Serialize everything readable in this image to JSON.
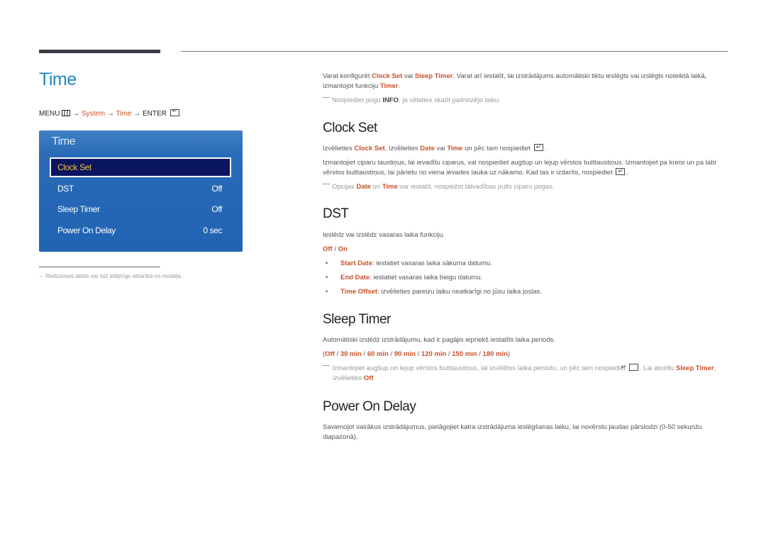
{
  "page": {
    "title": "Time",
    "menu_path": {
      "menu": "MENU",
      "arrow": "→",
      "system": "System",
      "time": "Time",
      "enter": "ENTER"
    }
  },
  "osd": {
    "title": "Time",
    "items": [
      {
        "label": "Clock Set",
        "value": ""
      },
      {
        "label": "DST",
        "value": "Off"
      },
      {
        "label": "Sleep Timer",
        "value": "Off"
      },
      {
        "label": "Power On Delay",
        "value": "0 sec"
      }
    ],
    "footnote": "Redzamais attēls var būt atšķirīgs atkarībā no modeļa."
  },
  "intro": {
    "t1": "Varat konfigurēt ",
    "clock_set": "Clock Set",
    "t2": " vai ",
    "sleep_timer": "Sleep Timer",
    "t3": ". Varat arī iestatīt, lai izstrādājums automātiski tiktu ieslēgts vai izslēgts noteiktā laikā, izmantojot funkciju ",
    "timer": "Timer",
    "t4": ".",
    "note_t1": "Nospiediet pogu ",
    "note_info": "INFO",
    "note_t2": ", ja vēlaties skatīt pašreizējo laiku."
  },
  "clock_set": {
    "heading": "Clock Set",
    "p1_t1": "Izvēlieties ",
    "p1_clock": "Clock Set",
    "p1_t2": ". Izvēlieties ",
    "p1_date": "Date",
    "p1_t3": " vai ",
    "p1_time": "Time",
    "p1_t4": " un pēc tam nospiediet",
    "p1_t5": ".",
    "p2_t1": "Izmantojiet ciparu taustiņus, lai ievadītu ciparus, vai nospiediet augšup un lejup vērstos bulttaustiņus. Izmantojiet pa kreisi un pa labi vērstos bulttaustiņus, lai pārietu no viena ievades lauka uz nākamo. Kad tas ir izdarīts, nospiediet",
    "p2_t2": ".",
    "note_t1": "Opcijas ",
    "note_date": "Date",
    "note_t2": " un ",
    "note_time": "Time",
    "note_t3": " var iestatīt, nospiežot tālvadības pults ciparu pogas."
  },
  "dst": {
    "heading": "DST",
    "desc": "Ieslēdz vai izslēdz vasaras laika funkciju.",
    "opt_off": "Off",
    "opt_sep": " / ",
    "opt_on": "On",
    "bullets": [
      {
        "term": "Start Date",
        "text": ": iestatiet vasaras laika sākuma datumu."
      },
      {
        "term": "End Date",
        "text": ": iestatiet vasaras laika beigu datumu."
      },
      {
        "term": "Time Offset",
        "text": ": izvēlieties pareizu laiku neatkarīgi no jūsu laika joslas."
      }
    ]
  },
  "sleep_timer": {
    "heading": "Sleep Timer",
    "desc": "Automātiski izslēdz izstrādājumu, kad ir pagājis iepriekš iestatīts laika periods.",
    "options": [
      "Off",
      "30 min",
      "60 min",
      "90 min",
      "120 min",
      "150 min",
      "180 min"
    ],
    "note_t1": "Izmantojiet augšup un lejup vērstos bulttaustiņus, lai izvēlētos laika periodu, un pēc tam nospiediet",
    "note_t2": ". Lai atceltu ",
    "note_sleep_timer": "Sleep Timer",
    "note_t3": ", izvēlieties ",
    "note_off": "Off",
    "note_t4": "."
  },
  "power_on_delay": {
    "heading": "Power On Delay",
    "desc": "Savienojot vairākus izstrādājumus, pielāgojiet katra izstrādājuma ieslēgšanas laiku, lai novērstu jaudas pārslodzi (0-50 sekunžu diapazonā)."
  }
}
